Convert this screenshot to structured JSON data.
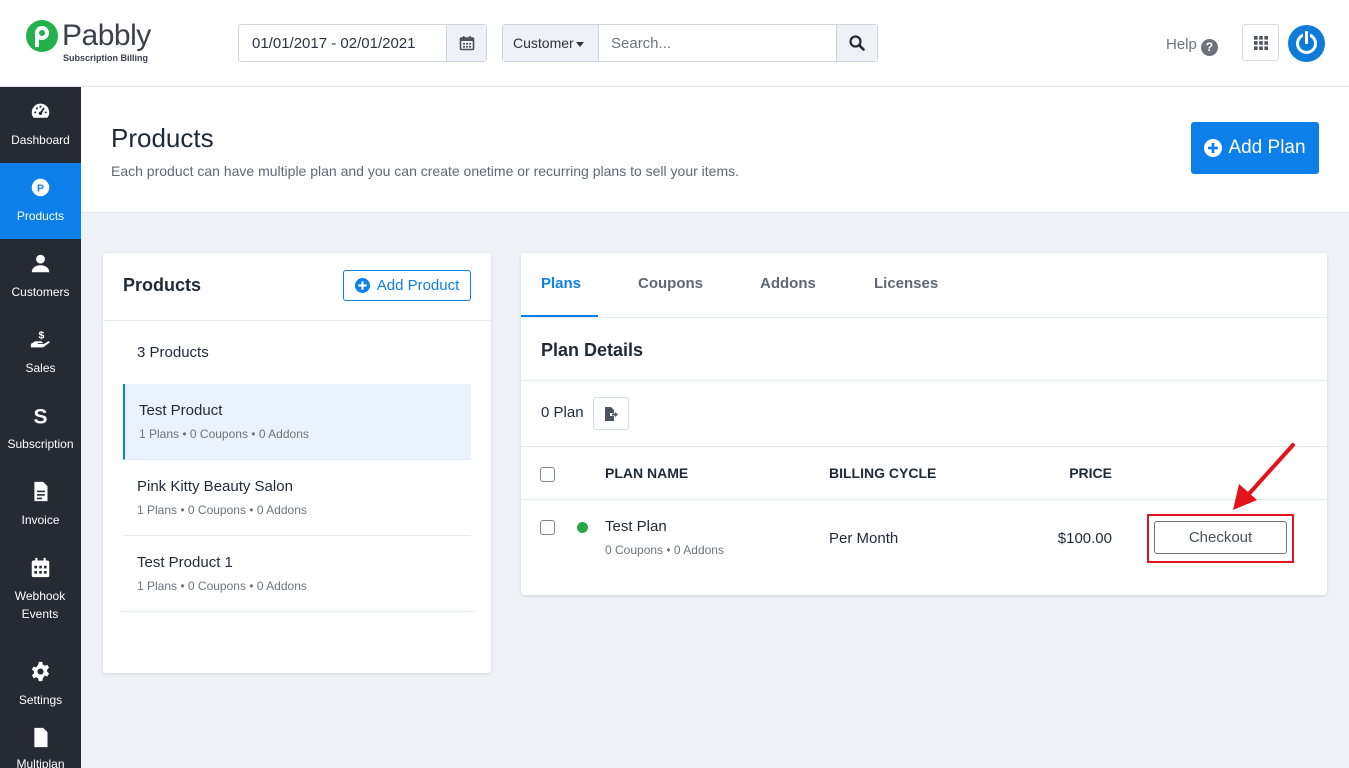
{
  "header": {
    "logo_name": "Pabbly",
    "logo_subtitle": "Subscription Billing",
    "date_range": "01/01/2017 - 02/01/2021",
    "search_filter": "Customer",
    "search_placeholder": "Search...",
    "help_label": "Help"
  },
  "sidebar": {
    "items": [
      {
        "label": "Dashboard",
        "icon": "dashboard-icon"
      },
      {
        "label": "Products",
        "icon": "products-icon",
        "active": true
      },
      {
        "label": "Customers",
        "icon": "user-icon"
      },
      {
        "label": "Sales",
        "icon": "sales-icon"
      },
      {
        "label": "Subscription",
        "icon": "subscription-icon"
      },
      {
        "label": "Invoice",
        "icon": "invoice-icon"
      },
      {
        "label": "Webhook Events",
        "icon": "calendar-icon"
      },
      {
        "label": "Settings",
        "icon": "gear-icon"
      },
      {
        "label": "Multiplan",
        "icon": "file-icon"
      }
    ]
  },
  "page": {
    "title": "Products",
    "subtitle": "Each product can have multiple plan and you can create onetime or recurring plans to sell your items.",
    "add_plan_label": "Add Plan"
  },
  "products_panel": {
    "title": "Products",
    "add_product_label": "Add Product",
    "count_text": "3 Products",
    "items": [
      {
        "name": "Test Product",
        "plans": "1 Plans",
        "coupons": "0 Coupons",
        "addons": "0 Addons"
      },
      {
        "name": "Pink Kitty Beauty Salon",
        "plans": "1 Plans",
        "coupons": "0 Coupons",
        "addons": "0 Addons"
      },
      {
        "name": "Test Product 1",
        "plans": "1 Plans",
        "coupons": "0 Coupons",
        "addons": "0 Addons"
      }
    ]
  },
  "plans_panel": {
    "tabs": [
      "Plans",
      "Coupons",
      "Addons",
      "Licenses"
    ],
    "section_title": "Plan Details",
    "plan_count": "0 Plan",
    "columns": {
      "name": "PLAN NAME",
      "cycle": "BILLING CYCLE",
      "price": "PRICE"
    },
    "rows": [
      {
        "name": "Test Plan",
        "coupons": "0 Coupons",
        "addons": "0 Addons",
        "cycle": "Per Month",
        "price": "$100.00",
        "action": "Checkout"
      }
    ]
  },
  "colors": {
    "accent": "#0d7fe8",
    "sidebar_bg": "#252a33",
    "status_active": "#28a745",
    "annotation_red": "#e3141b"
  }
}
